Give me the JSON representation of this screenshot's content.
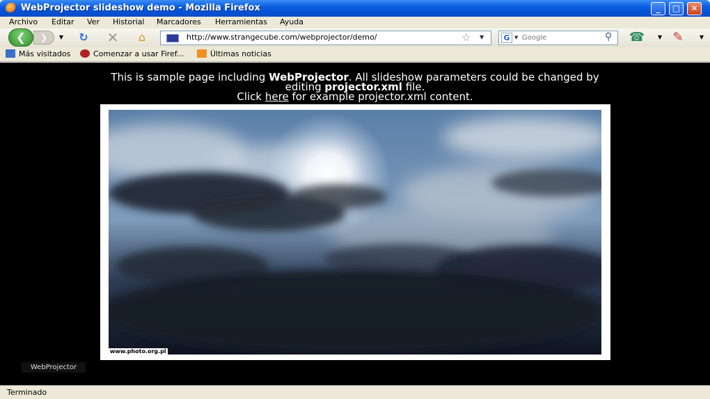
{
  "window": {
    "title": "WebProjector slideshow demo - Mozilla Firefox"
  },
  "menu": [
    "Archivo",
    "Editar",
    "Ver",
    "Historial",
    "Marcadores",
    "Herramientas",
    "Ayuda"
  ],
  "nav": {
    "url": "http://www.strangecube.com/webprojector/demo/",
    "search_placeholder": "Google",
    "search_engine_letter": "G"
  },
  "bookmarks": [
    "Más visitados",
    "Comenzar a usar Firef...",
    "Últimas noticias"
  ],
  "page": {
    "intro_1a": "This is sample page including ",
    "intro_1b": "WebProjector",
    "intro_1c": ". All slideshow parameters could be changed by",
    "intro_2a": "editing ",
    "intro_2b": "projector.xml",
    "intro_2c": " file.",
    "intro_3a": "Click ",
    "intro_3link": "here",
    "intro_3b": " for example projector.xml content.",
    "photo_credit": "www.photo.org.pl",
    "logo": "WebProjector"
  },
  "status": {
    "text": "Terminado"
  },
  "colors": {
    "titlebar": "#0552d6",
    "content_bg": "#000000",
    "chrome": "#ece9d8"
  }
}
